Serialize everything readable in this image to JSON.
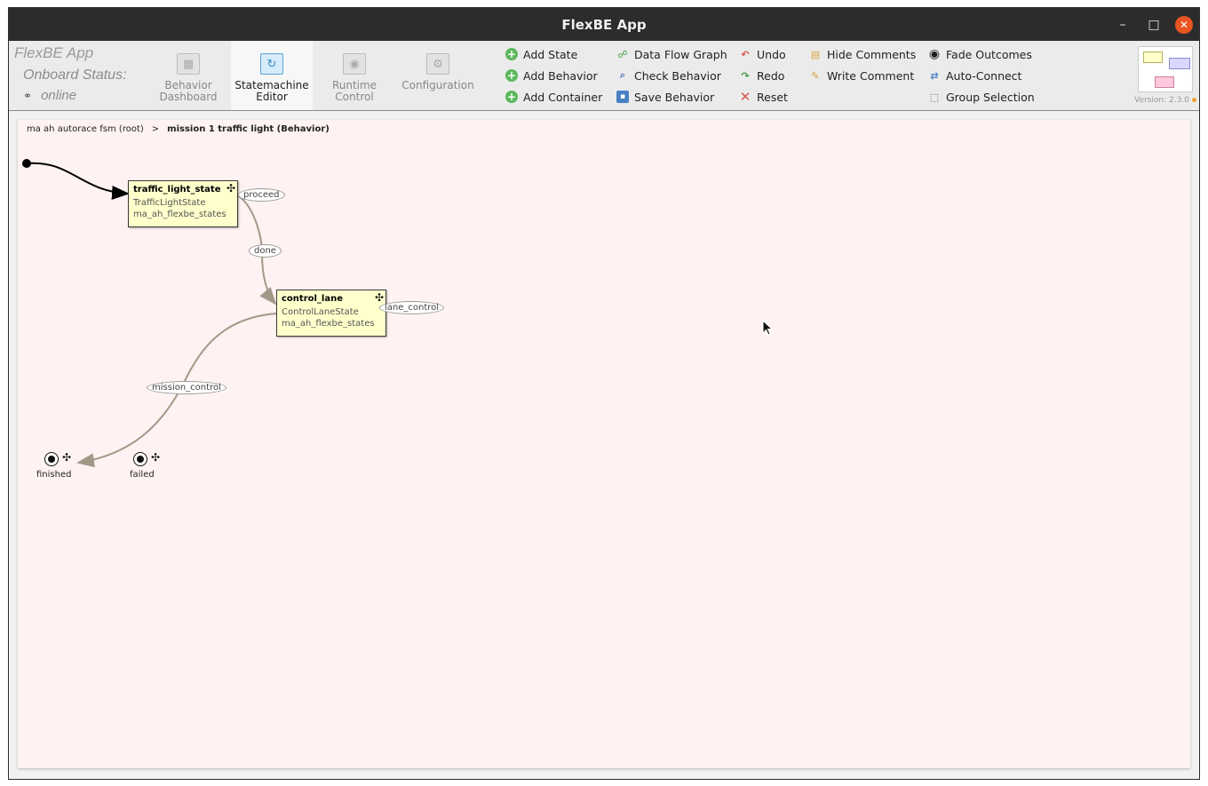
{
  "window": {
    "title": "FlexBE App"
  },
  "window_controls": {
    "minimize": "–",
    "maximize": "□",
    "close": "✕"
  },
  "brand": {
    "name": "FlexBE App",
    "onboard_status_label": "Onboard Status:",
    "onboard_status_value": "online",
    "link_glyph": "⚭"
  },
  "nav_tabs": [
    {
      "line1": "Behavior",
      "line2": "Dashboard",
      "icon": "grid-icon",
      "glyph": "▦"
    },
    {
      "line1": "Statemachine",
      "line2": "Editor",
      "icon": "statemachine-icon",
      "glyph": "↻"
    },
    {
      "line1": "Runtime",
      "line2": "Control",
      "icon": "runtime-icon",
      "glyph": "◉"
    },
    {
      "line1": "Configuration",
      "line2": "",
      "icon": "gear-icon",
      "glyph": "⚙"
    }
  ],
  "toolbar": {
    "add_state": "Add State",
    "add_behavior": "Add Behavior",
    "add_container": "Add Container",
    "data_flow_graph": "Data Flow Graph",
    "check_behavior": "Check Behavior",
    "save_behavior": "Save Behavior",
    "undo": "Undo",
    "redo": "Redo",
    "reset": "Reset",
    "hide_comments": "Hide Comments",
    "write_comment": "Write Comment",
    "fade_outcomes": "Fade Outcomes",
    "auto_connect": "Auto-Connect",
    "group_selection": "Group Selection",
    "glyphs": {
      "plus": "+",
      "flow": "☍",
      "check": "⌕",
      "save": "▪",
      "undo": "↶",
      "redo": "↷",
      "reset": "✕",
      "hide": "▤",
      "write": "✎",
      "fade": "◉",
      "auto": "⇄",
      "group": "⬚"
    }
  },
  "version": "Version: 2.3.0",
  "breadcrumb": {
    "root": "ma ah autorace fsm (root)",
    "separator": ">",
    "current": "mission 1 traffic light (Behavior)"
  },
  "states": [
    {
      "name": "traffic_light_state",
      "class": "TrafficLightState",
      "package": "ma_ah_flexbe_states"
    },
    {
      "name": "control_lane",
      "class": "ControlLaneState",
      "package": "ma_ah_flexbe_states"
    }
  ],
  "outcome_labels": {
    "proceed": "proceed",
    "done": "done",
    "lane_control": "lane_control",
    "mission_control": "mission_control"
  },
  "outcomes": [
    {
      "label": "finished"
    },
    {
      "label": "failed"
    }
  ],
  "move_glyph": "✣"
}
